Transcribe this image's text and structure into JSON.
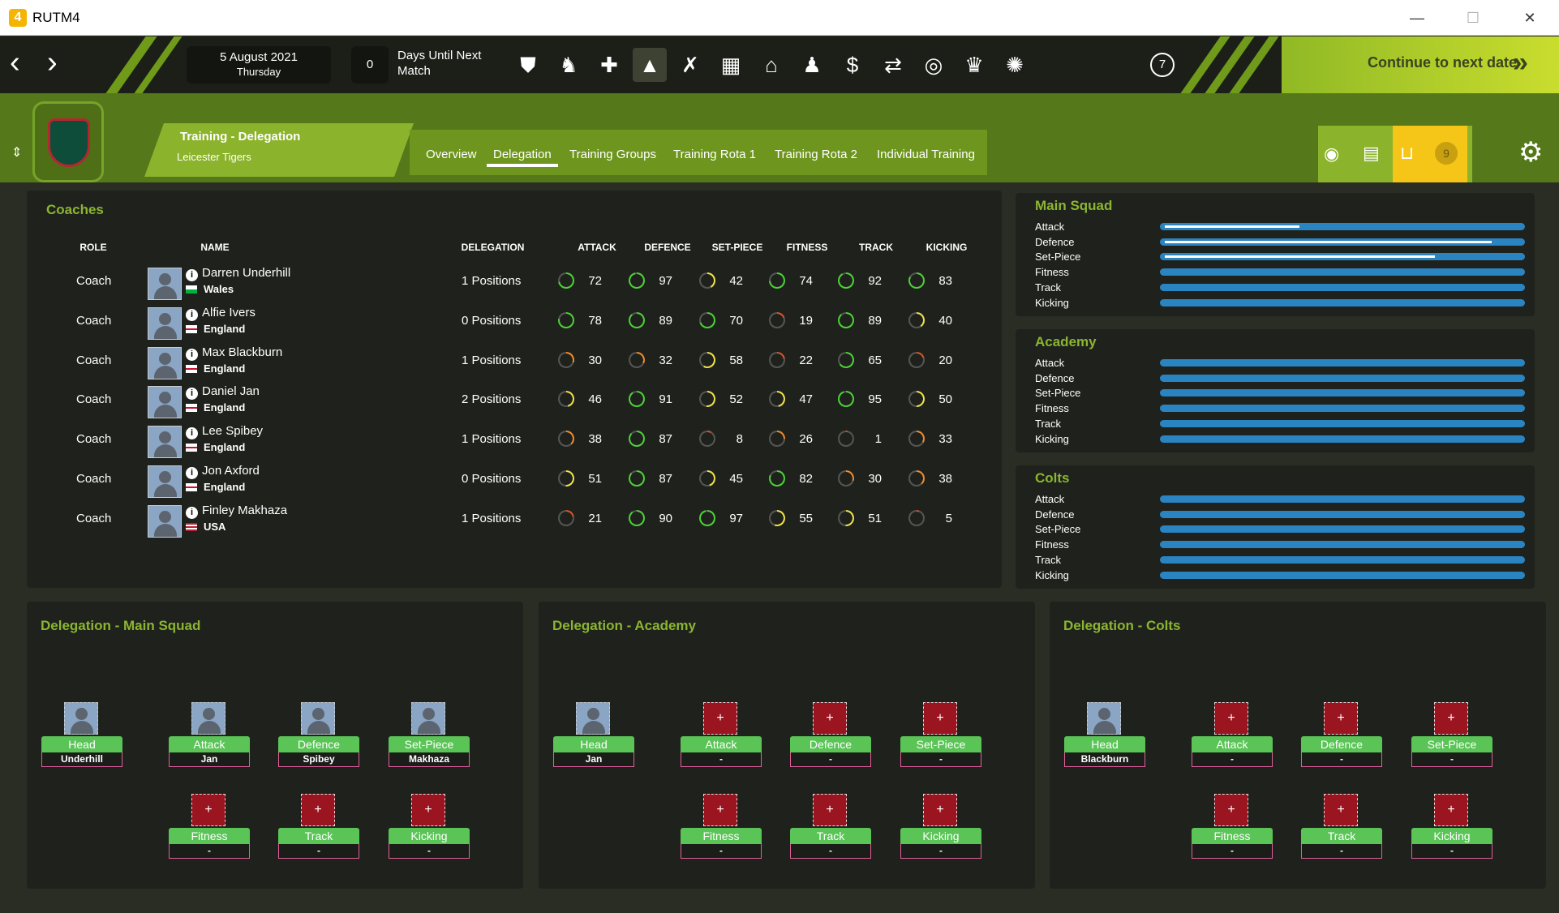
{
  "window": {
    "icon": "4",
    "title": "RUTM4",
    "minimize": "—",
    "maximize": "☐",
    "close": "✕"
  },
  "topbar": {
    "date": "5 August 2021",
    "weekday": "Thursday",
    "days_count": "0",
    "days_label": "Days Until Next Match",
    "notification_count": "7",
    "continue_label": "Continue to next date",
    "continue_arrow": "»"
  },
  "subheader": {
    "section_title": "Training - Delegation",
    "club": "Leicester Tigers",
    "tabs": [
      "Overview",
      "Delegation",
      "Training Groups",
      "Training Rota 1",
      "Training Rota 2",
      "Individual Training"
    ],
    "inbox_count": "9"
  },
  "coaches": {
    "title": "Coaches",
    "headers": {
      "role": "ROLE",
      "name": "NAME",
      "delegation": "DELEGATION",
      "attack": "ATTACK",
      "defence": "DEFENCE",
      "setpiece": "SET-PIECE",
      "fitness": "FITNESS",
      "track": "TRACK",
      "kicking": "KICKING"
    },
    "rows": [
      {
        "role": "Coach",
        "name": "Darren Underhill",
        "country": "Wales",
        "delegation": "1 Positions",
        "stats": [
          "72",
          "97",
          "42",
          "74",
          "92",
          "83"
        ]
      },
      {
        "role": "Coach",
        "name": "Alfie Ivers",
        "country": "England",
        "delegation": "0 Positions",
        "stats": [
          "78",
          "89",
          "70",
          "19",
          "89",
          "40"
        ]
      },
      {
        "role": "Coach",
        "name": "Max Blackburn",
        "country": "England",
        "delegation": "1 Positions",
        "stats": [
          "30",
          "32",
          "58",
          "22",
          "65",
          "20"
        ]
      },
      {
        "role": "Coach",
        "name": "Daniel Jan",
        "country": "England",
        "delegation": "2 Positions",
        "stats": [
          "46",
          "91",
          "52",
          "47",
          "95",
          "50"
        ]
      },
      {
        "role": "Coach",
        "name": "Lee Spibey",
        "country": "England",
        "delegation": "1 Positions",
        "stats": [
          "38",
          "87",
          "8",
          "26",
          "1",
          "33"
        ]
      },
      {
        "role": "Coach",
        "name": "Jon Axford",
        "country": "England",
        "delegation": "0 Positions",
        "stats": [
          "51",
          "87",
          "45",
          "82",
          "30",
          "38"
        ]
      },
      {
        "role": "Coach",
        "name": "Finley Makhaza",
        "country": "USA",
        "delegation": "1 Positions",
        "stats": [
          "21",
          "90",
          "97",
          "55",
          "51",
          "5"
        ]
      }
    ]
  },
  "squad_bars": [
    {
      "title": "Main Squad",
      "labels": [
        "Attack",
        "Defence",
        "Set-Piece",
        "Fitness",
        "Track",
        "Kicking"
      ],
      "fill": [
        0.38,
        0.92,
        0.76,
        0,
        0,
        0
      ]
    },
    {
      "title": "Academy",
      "labels": [
        "Attack",
        "Defence",
        "Set-Piece",
        "Fitness",
        "Track",
        "Kicking"
      ],
      "fill": [
        0,
        0,
        0,
        0,
        0,
        0
      ]
    },
    {
      "title": "Colts",
      "labels": [
        "Attack",
        "Defence",
        "Set-Piece",
        "Fitness",
        "Track",
        "Kicking"
      ],
      "fill": [
        0,
        0,
        0,
        0,
        0,
        0
      ]
    }
  ],
  "delegation": [
    {
      "title": "Delegation - Main Squad",
      "slots": [
        {
          "role": "Head",
          "name": "Underhill",
          "filled": true
        },
        {
          "role": "Attack",
          "name": "Jan",
          "filled": true
        },
        {
          "role": "Defence",
          "name": "Spibey",
          "filled": true
        },
        {
          "role": "Set-Piece",
          "name": "Makhaza",
          "filled": true
        },
        {
          "role": "Fitness",
          "name": "-",
          "filled": false
        },
        {
          "role": "Track",
          "name": "-",
          "filled": false
        },
        {
          "role": "Kicking",
          "name": "-",
          "filled": false
        }
      ]
    },
    {
      "title": "Delegation - Academy",
      "slots": [
        {
          "role": "Head",
          "name": "Jan",
          "filled": true
        },
        {
          "role": "Attack",
          "name": "-",
          "filled": false
        },
        {
          "role": "Defence",
          "name": "-",
          "filled": false
        },
        {
          "role": "Set-Piece",
          "name": "-",
          "filled": false
        },
        {
          "role": "Fitness",
          "name": "-",
          "filled": false
        },
        {
          "role": "Track",
          "name": "-",
          "filled": false
        },
        {
          "role": "Kicking",
          "name": "-",
          "filled": false
        }
      ]
    },
    {
      "title": "Delegation - Colts",
      "slots": [
        {
          "role": "Head",
          "name": "Blackburn",
          "filled": true
        },
        {
          "role": "Attack",
          "name": "-",
          "filled": false
        },
        {
          "role": "Defence",
          "name": "-",
          "filled": false
        },
        {
          "role": "Set-Piece",
          "name": "-",
          "filled": false
        },
        {
          "role": "Fitness",
          "name": "-",
          "filled": false
        },
        {
          "role": "Track",
          "name": "-",
          "filled": false
        },
        {
          "role": "Kicking",
          "name": "-",
          "filled": false
        }
      ]
    }
  ],
  "add_glyph": "+",
  "colors": {
    "accent": "#8bb531",
    "good": "#4cd137",
    "mid": "#f1e14a",
    "low": "#f08a2c",
    "poor": "#d9532c",
    "bar": "#2b84c2"
  }
}
